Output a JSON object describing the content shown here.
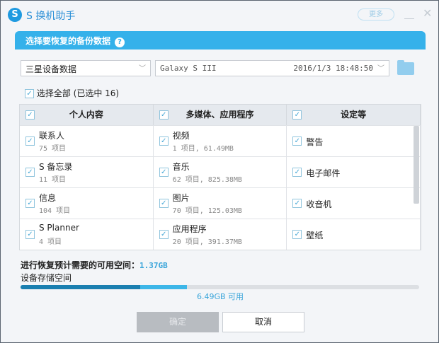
{
  "title": {
    "logo": "S",
    "app": "S 换机助手",
    "more": "更多"
  },
  "panel": {
    "title": "选择要恢复的备份数据",
    "help": "?"
  },
  "source": {
    "selected": "三星设备数据",
    "device": "Galaxy S III",
    "date": "2016/1/3 18:48:50"
  },
  "select_all": "选择全部 (已选中 16)",
  "columns": [
    {
      "header": "个人内容",
      "items": [
        {
          "name": "联系人",
          "sub": "75 项目"
        },
        {
          "name": "S 备忘录",
          "sub": "11 项目"
        },
        {
          "name": "信息",
          "sub": "104 项目"
        },
        {
          "name": "S Planner",
          "sub": "4 项目"
        }
      ]
    },
    {
      "header": "多媒体、应用程序",
      "items": [
        {
          "name": "视频",
          "sub": "1 项目, 61.49MB"
        },
        {
          "name": "音乐",
          "sub": "62 项目, 825.38MB"
        },
        {
          "name": "图片",
          "sub": "70 项目, 125.03MB"
        },
        {
          "name": "应用程序",
          "sub": "20 项目, 391.37MB"
        }
      ]
    },
    {
      "header": "设定等",
      "items": [
        {
          "name": "警告"
        },
        {
          "name": "电子邮件"
        },
        {
          "name": "收音机"
        },
        {
          "name": "壁纸"
        }
      ]
    }
  ],
  "storage": {
    "required_label": "进行恢复预计需要的可用空间：",
    "required": "1.37GB",
    "device_label": "设备存储空间",
    "used_fraction": 0.3,
    "required_end_fraction": 0.417,
    "available": "6.49GB 可用"
  },
  "buttons": {
    "ok": "确定",
    "cancel": "取消"
  },
  "colors": {
    "accent": "#35b1ea",
    "used": "#1a7fb0",
    "required": "#3cb6e8"
  }
}
